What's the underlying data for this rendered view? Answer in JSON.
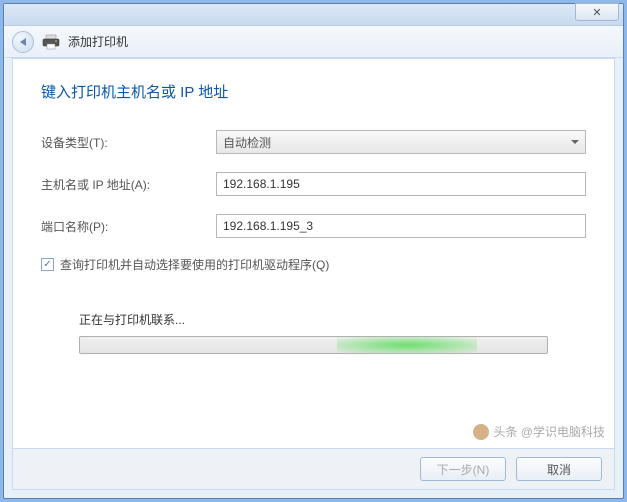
{
  "titlebar": {
    "close_glyph": "✕"
  },
  "header": {
    "title": "添加打印机"
  },
  "page": {
    "title": "键入打印机主机名或 IP 地址"
  },
  "form": {
    "device_type": {
      "label": "设备类型(T):",
      "value": "自动检测"
    },
    "host": {
      "label": "主机名或 IP 地址(A):",
      "value": "192.168.1.195"
    },
    "port": {
      "label": "端口名称(P):",
      "value": "192.168.1.195_3"
    },
    "checkbox": {
      "label": "查询打印机并自动选择要使用的打印机驱动程序(Q)",
      "checked": true
    }
  },
  "progress": {
    "label": "正在与打印机联系..."
  },
  "buttons": {
    "next": "下一步(N)",
    "cancel": "取消"
  },
  "watermark": "头条 @学识电脑科技"
}
